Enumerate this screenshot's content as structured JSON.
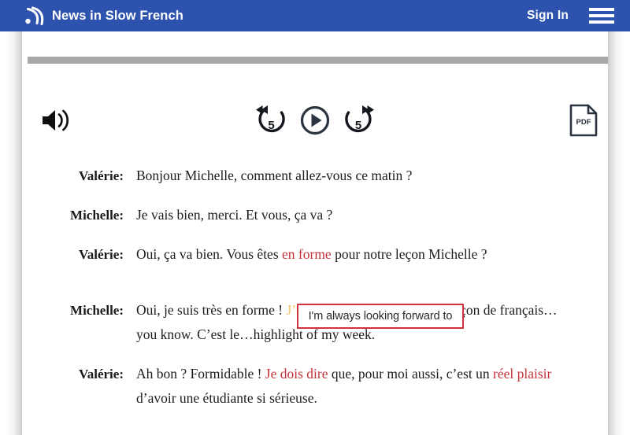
{
  "header": {
    "brand_title": "News in Slow French",
    "brand_icon": "audio-wave-icon",
    "signin_label": "Sign In",
    "menu_icon": "hamburger-menu-icon",
    "background_color": "#2d53ae",
    "text_color": "#ffffff"
  },
  "player": {
    "progress_color": "#a9a9a9",
    "progress_percent": 0,
    "volume_icon": "volume-speaker-icon",
    "rewind_label": "5",
    "rewind_icon": "rewind-5-icon",
    "play_icon": "play-icon",
    "forward_label": "5",
    "forward_icon": "forward-5-icon",
    "pdf_label": "PDF",
    "pdf_icon": "pdf-document-icon",
    "icon_color": "#2b3340"
  },
  "tooltip": {
    "text": "I'm always looking forward to",
    "border_color": "#d0333b",
    "background_color": "#ffffff"
  },
  "colors": {
    "highlight_red": "#c8313a",
    "highlight_amber": "#f6c669",
    "body_text": "#1c1c1c"
  },
  "transcript": {
    "lines": [
      {
        "speaker": "Valérie:",
        "segments": [
          {
            "text": "Bonjour Michelle, comment allez-vous ce matin ?",
            "style": "plain"
          }
        ]
      },
      {
        "speaker": "Michelle:",
        "segments": [
          {
            "text": "Je vais bien, merci. Et vous, ça va ?",
            "style": "plain"
          }
        ]
      },
      {
        "speaker": "Valérie:",
        "segments": [
          {
            "text": "Oui, ça va bien. Vous êtes ",
            "style": "plain"
          },
          {
            "text": "en forme",
            "style": "red"
          },
          {
            "text": " pour notre leçon Michelle ?",
            "style": "plain"
          }
        ]
      },
      {
        "speaker": "Michelle:",
        "segments": [
          {
            "text": "Oui, je suis très en forme ! ",
            "style": "plain"
          },
          {
            "text": "J’ai toujours hâte de",
            "style": "amber"
          },
          {
            "text": " faire ma leçon de français…you know. C’est le…highlight of my week.",
            "style": "plain"
          }
        ]
      },
      {
        "speaker": "Valérie:",
        "segments": [
          {
            "text": "Ah bon ? Formidable ! ",
            "style": "plain"
          },
          {
            "text": "Je dois dire",
            "style": "red"
          },
          {
            "text": " que, pour moi aussi, c’est un ",
            "style": "plain"
          },
          {
            "text": "réel plaisir",
            "style": "red"
          },
          {
            "text": " d’avoir une étudiante si sérieuse.",
            "style": "plain"
          }
        ]
      }
    ]
  }
}
